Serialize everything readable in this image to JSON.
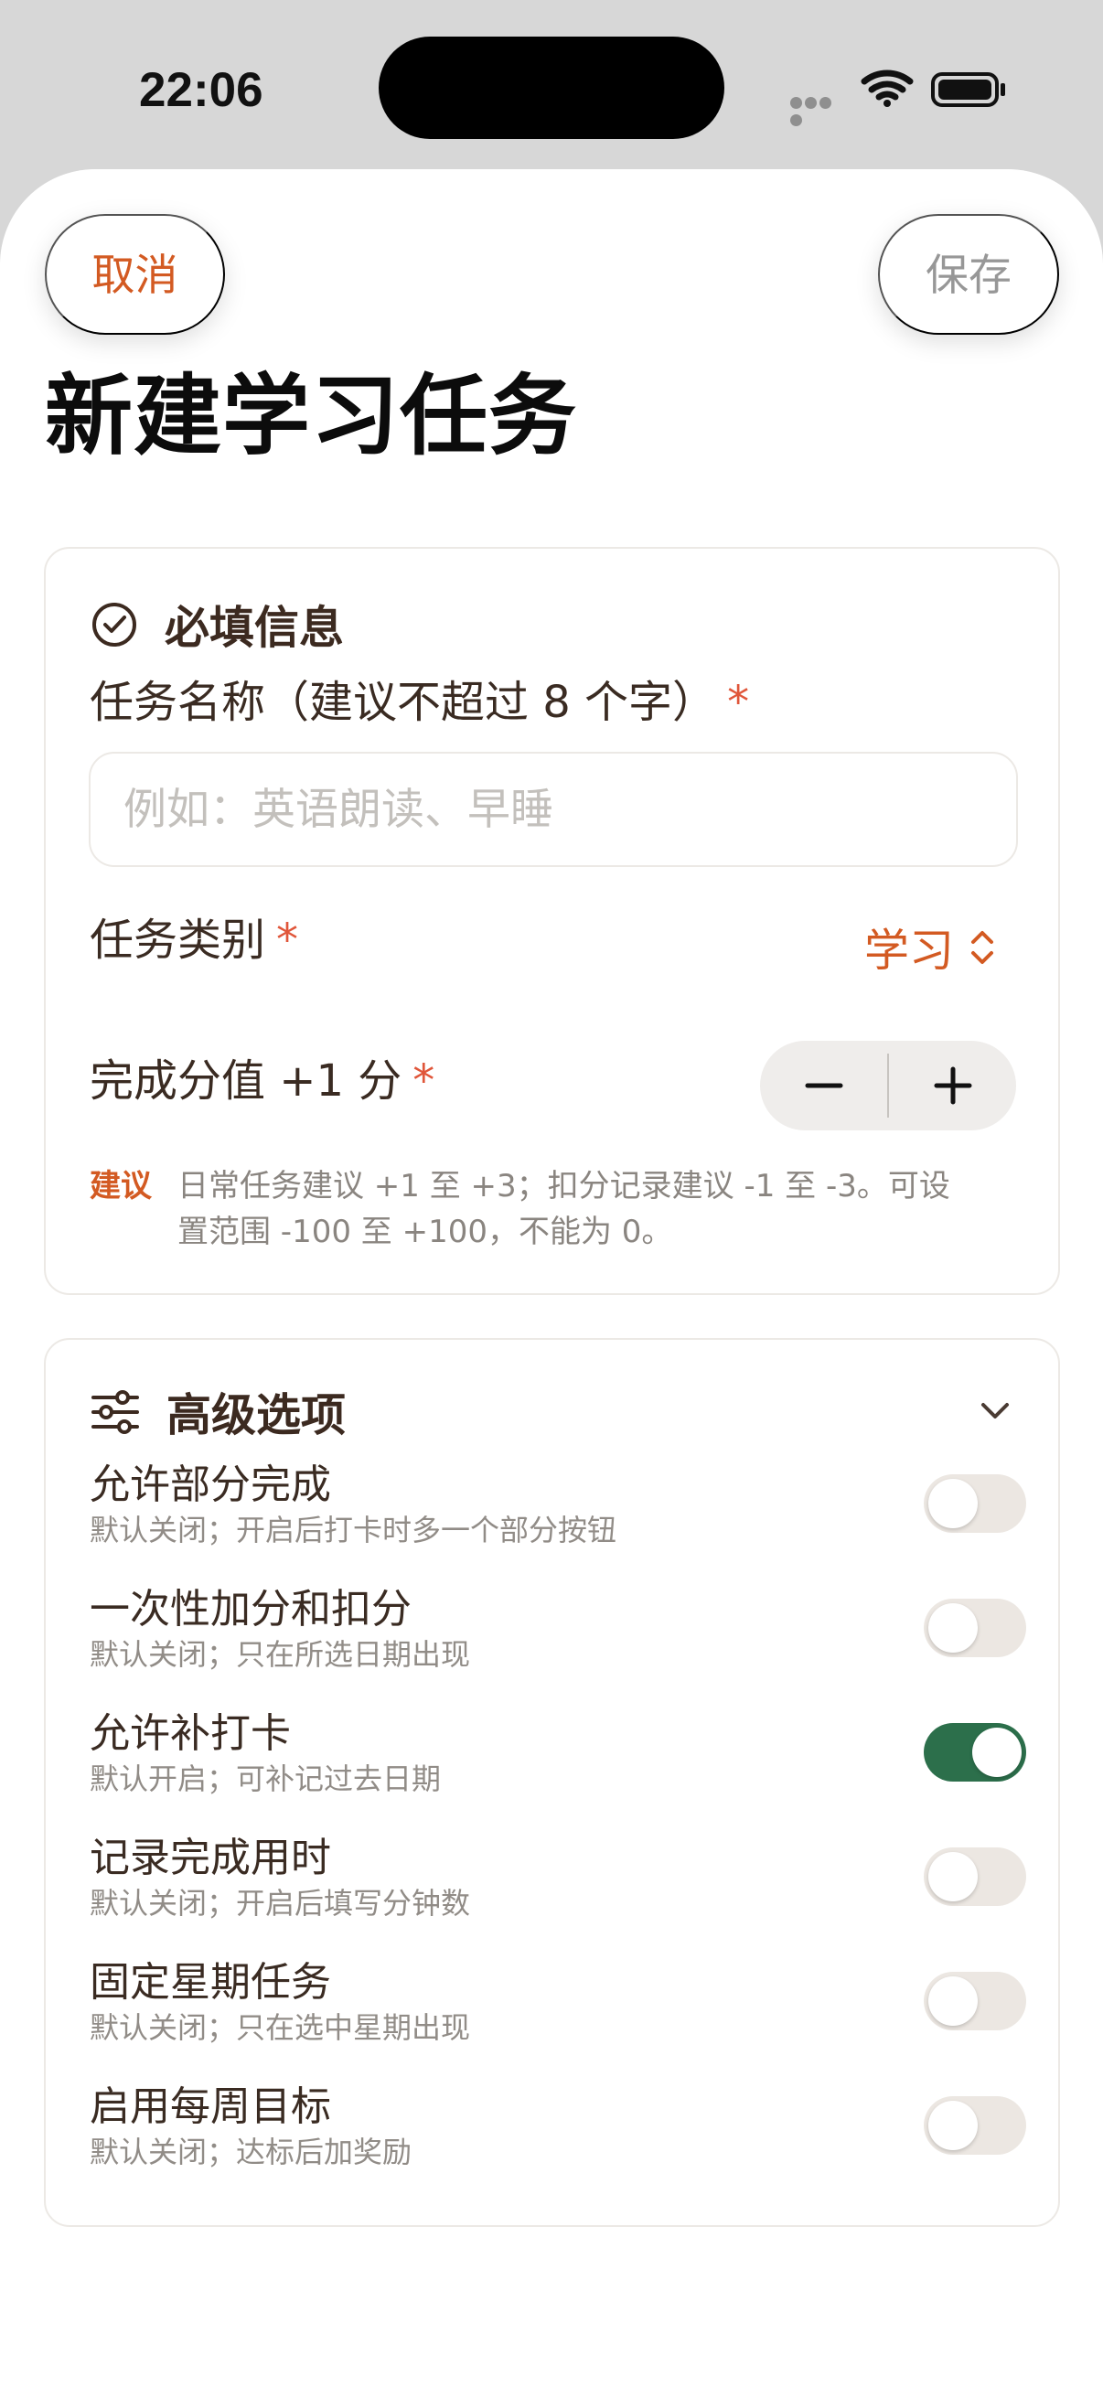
{
  "status_bar": {
    "time": "22:06"
  },
  "header": {
    "cancel_label": "取消",
    "save_label": "保存",
    "title": "新建学习任务"
  },
  "required_section": {
    "title": "必填信息",
    "name_label": "任务名称（建议不超过 8 个字）",
    "name_value": "",
    "name_placeholder": "例如：英语朗读、早睡",
    "category_label": "任务类别",
    "category_value": "学习",
    "score_label": "完成分值 +1 分",
    "required_mark": "*",
    "hint_tag": "建议",
    "hint_text": "日常任务建议 +1 至 +3；扣分记录建议 -1 至 -3。可设置范围 -100 至 +100，不能为 0。"
  },
  "advanced_section": {
    "title": "高级选项",
    "options": [
      {
        "title": "允许部分完成",
        "description": "默认关闭；开启后打卡时多一个部分按钮",
        "enabled": false
      },
      {
        "title": "一次性加分和扣分",
        "description": "默认关闭；只在所选日期出现",
        "enabled": false
      },
      {
        "title": "允许补打卡",
        "description": "默认开启；可补记过去日期",
        "enabled": true
      },
      {
        "title": "记录完成用时",
        "description": "默认关闭；开启后填写分钟数",
        "enabled": false
      },
      {
        "title": "固定星期任务",
        "description": "默认关闭；只在选中星期出现",
        "enabled": false
      },
      {
        "title": "启用每周目标",
        "description": "默认关闭；达标后加奖励",
        "enabled": false
      }
    ]
  },
  "colors": {
    "accent": "#d35a22",
    "required": "#e0563a",
    "toggle_on": "#2c6f4b",
    "toggle_off": "#ece7e2"
  },
  "icons": {
    "required_section": "check-circle-icon",
    "advanced_section": "sliders-icon",
    "category": "chevron-up-down-icon",
    "collapse": "chevron-down-icon",
    "minus": "minus-icon",
    "plus": "plus-icon"
  }
}
